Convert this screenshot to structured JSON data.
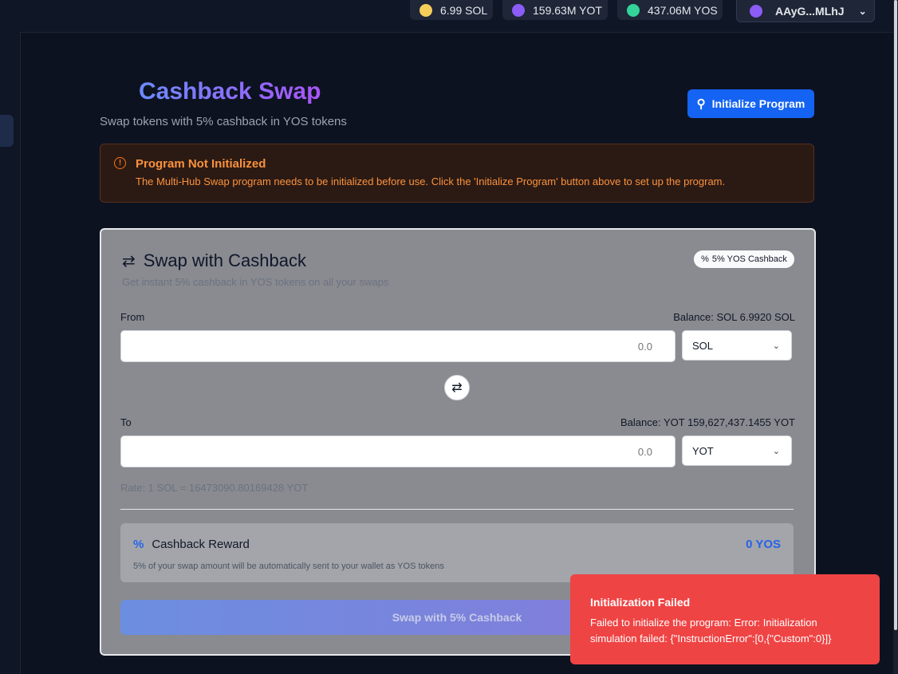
{
  "header": {
    "balances": [
      {
        "label": "6.99 SOL",
        "color": "#f5cd5a"
      },
      {
        "label": "159.63M YOT",
        "color": "#8b5cf6"
      },
      {
        "label": "437.06M YOS",
        "color": "#34d399"
      }
    ],
    "wallet": {
      "address": "AAyG...MLhJ",
      "color": "#8b5cf6"
    }
  },
  "page": {
    "title": "Cashback Swap",
    "subtitle": "Swap tokens with 5% cashback in YOS tokens",
    "init_button": "Initialize Program"
  },
  "alert": {
    "title": "Program Not Initialized",
    "message": "The Multi-Hub Swap program needs to be initialized before use. Click the 'Initialize Program' button above to set up the program."
  },
  "card": {
    "title": "Swap with Cashback",
    "subtitle": "Get instant 5% cashback in YOS tokens on all your swaps",
    "badge": "5% YOS Cashback",
    "from": {
      "label": "From",
      "balance": "Balance: SOL 6.9920 SOL",
      "placeholder": "0.0",
      "token": "SOL"
    },
    "to": {
      "label": "To",
      "balance": "Balance: YOT 159,627,437.1455 YOT",
      "placeholder": "0.0",
      "token": "YOT"
    },
    "rate": "Rate: 1 SOL = 16473090.80169428 YOT",
    "cashback": {
      "title": "Cashback Reward",
      "amount": "0 YOS",
      "note": "5% of your swap amount will be automatically sent to your wallet as YOS tokens"
    },
    "swap_button": "Swap with 5% Cashback"
  },
  "toast": {
    "title": "Initialization Failed",
    "message": "Failed to initialize the program: Error: Initialization simulation failed: {\"InstructionError\":[0,{\"Custom\":0}]}"
  }
}
